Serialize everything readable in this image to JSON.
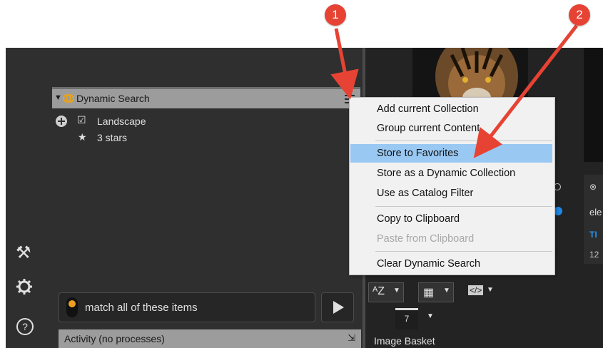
{
  "dynamic_search": {
    "title": "Dynamic Search",
    "criteria": [
      {
        "label": "Landscape"
      },
      {
        "label": "3 stars"
      }
    ]
  },
  "match": {
    "label": "match all of these items"
  },
  "activity": {
    "label": "Activity (no processes)"
  },
  "context_menu": {
    "items": [
      {
        "label": "Add current Collection",
        "enabled": true
      },
      {
        "label": "Group current Content",
        "enabled": true
      },
      {
        "label": "Store to Favorites",
        "enabled": true,
        "highlighted": true
      },
      {
        "label": "Store as a Dynamic Collection",
        "enabled": true
      },
      {
        "label": "Use as Catalog Filter",
        "enabled": true
      },
      {
        "label": "Copy to Clipboard",
        "enabled": true
      },
      {
        "label": "Paste from Clipboard",
        "enabled": false
      },
      {
        "label": "Clear Dynamic Search",
        "enabled": true
      }
    ]
  },
  "callouts": [
    "1",
    "2"
  ],
  "basket": {
    "label": "Image Basket",
    "count": "7"
  },
  "card": {
    "line1": "ele",
    "line2": "TI",
    "line3": "12"
  },
  "colors": {
    "accent": "#e64334",
    "highlight": "#99c9f3",
    "panel": "#2f2f2f",
    "header": "#9c9c9c"
  }
}
